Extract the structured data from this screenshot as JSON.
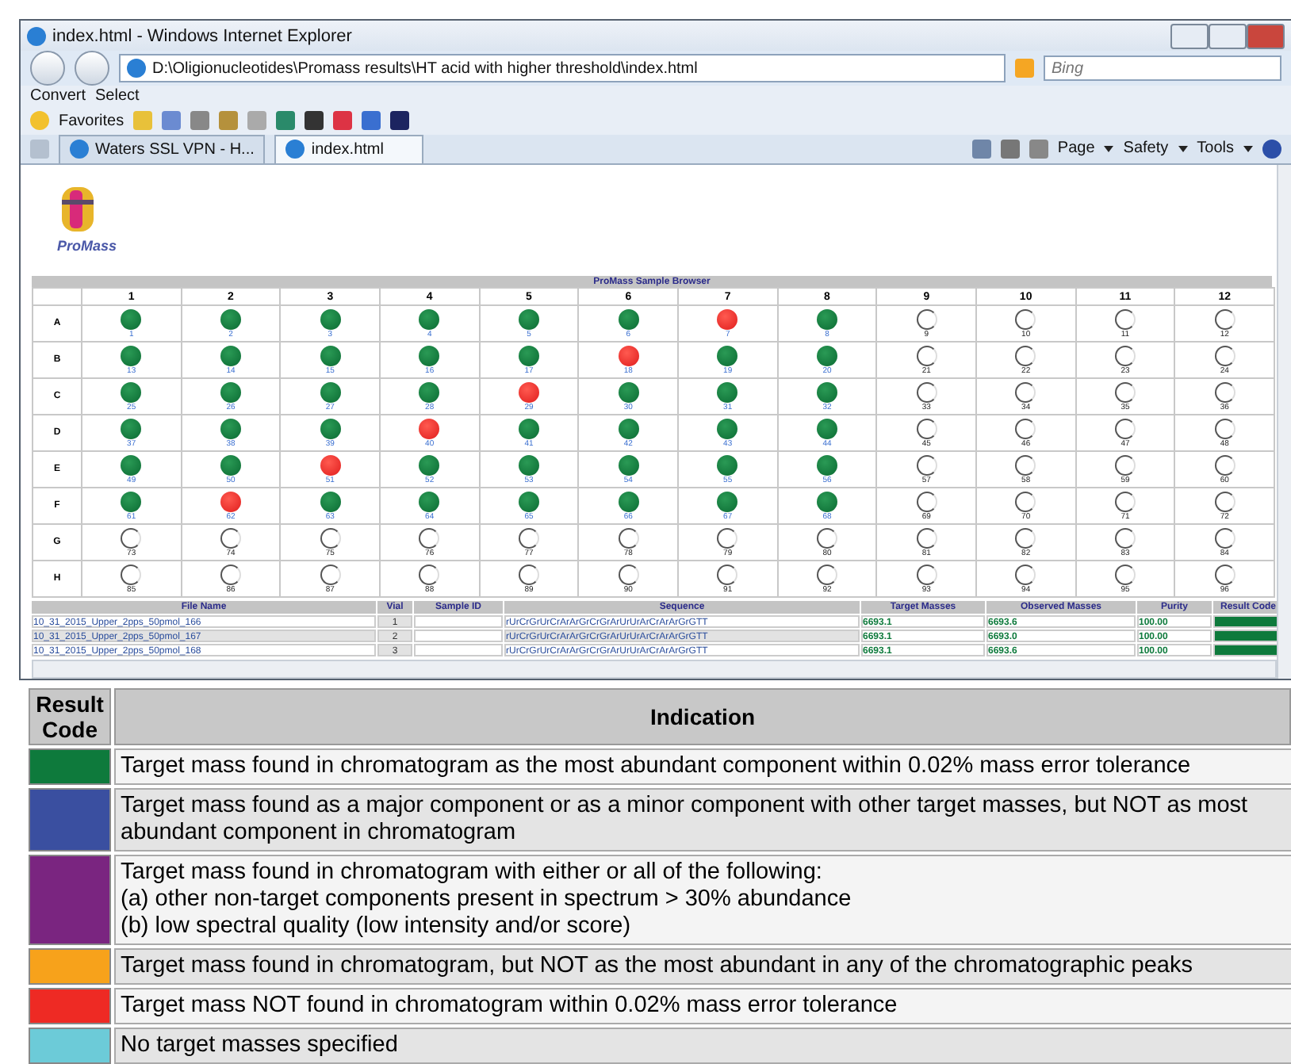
{
  "window": {
    "title": "index.html - Windows Internet Explorer"
  },
  "address_bar": {
    "url": "D:\\Oligionucleotides\\Promass results\\HT acid with higher threshold\\index.html",
    "search_placeholder": "Bing"
  },
  "command_bar": {
    "items": [
      "Convert",
      "Select"
    ]
  },
  "favorites_bar": {
    "label": "Favorites"
  },
  "tabs": [
    {
      "label": "Waters SSL VPN - H...",
      "selected": false
    },
    {
      "label": "index.html",
      "selected": true
    }
  ],
  "ie_toolbar": {
    "items": [
      "Page",
      "Safety",
      "Tools"
    ]
  },
  "logo": {
    "text": "ProMass"
  },
  "plate": {
    "title": "ProMass Sample Browser",
    "columns": [
      "1",
      "2",
      "3",
      "4",
      "5",
      "6",
      "7",
      "8",
      "9",
      "10",
      "11",
      "12"
    ],
    "rows": [
      {
        "label": "A",
        "wells": [
          {
            "n": "1",
            "kind": "found"
          },
          {
            "n": "2",
            "kind": "found"
          },
          {
            "n": "3",
            "kind": "found"
          },
          {
            "n": "4",
            "kind": "found"
          },
          {
            "n": "5",
            "kind": "found"
          },
          {
            "n": "6",
            "kind": "found"
          },
          {
            "n": "7",
            "kind": "not_found"
          },
          {
            "n": "8",
            "kind": "found"
          },
          {
            "n": "9",
            "kind": "empty"
          },
          {
            "n": "10",
            "kind": "empty"
          },
          {
            "n": "11",
            "kind": "empty"
          },
          {
            "n": "12",
            "kind": "empty"
          }
        ]
      },
      {
        "label": "B",
        "wells": [
          {
            "n": "13",
            "kind": "found"
          },
          {
            "n": "14",
            "kind": "found"
          },
          {
            "n": "15",
            "kind": "found"
          },
          {
            "n": "16",
            "kind": "found"
          },
          {
            "n": "17",
            "kind": "found"
          },
          {
            "n": "18",
            "kind": "not_found"
          },
          {
            "n": "19",
            "kind": "found"
          },
          {
            "n": "20",
            "kind": "found"
          },
          {
            "n": "21",
            "kind": "empty"
          },
          {
            "n": "22",
            "kind": "empty"
          },
          {
            "n": "23",
            "kind": "empty"
          },
          {
            "n": "24",
            "kind": "empty"
          }
        ]
      },
      {
        "label": "C",
        "wells": [
          {
            "n": "25",
            "kind": "found"
          },
          {
            "n": "26",
            "kind": "found"
          },
          {
            "n": "27",
            "kind": "found"
          },
          {
            "n": "28",
            "kind": "found"
          },
          {
            "n": "29",
            "kind": "not_found"
          },
          {
            "n": "30",
            "kind": "found"
          },
          {
            "n": "31",
            "kind": "found"
          },
          {
            "n": "32",
            "kind": "found"
          },
          {
            "n": "33",
            "kind": "empty"
          },
          {
            "n": "34",
            "kind": "empty"
          },
          {
            "n": "35",
            "kind": "empty"
          },
          {
            "n": "36",
            "kind": "empty"
          }
        ]
      },
      {
        "label": "D",
        "wells": [
          {
            "n": "37",
            "kind": "found"
          },
          {
            "n": "38",
            "kind": "found"
          },
          {
            "n": "39",
            "kind": "found"
          },
          {
            "n": "40",
            "kind": "not_found"
          },
          {
            "n": "41",
            "kind": "found"
          },
          {
            "n": "42",
            "kind": "found"
          },
          {
            "n": "43",
            "kind": "found"
          },
          {
            "n": "44",
            "kind": "found"
          },
          {
            "n": "45",
            "kind": "empty"
          },
          {
            "n": "46",
            "kind": "empty"
          },
          {
            "n": "47",
            "kind": "empty"
          },
          {
            "n": "48",
            "kind": "empty"
          }
        ]
      },
      {
        "label": "E",
        "wells": [
          {
            "n": "49",
            "kind": "found"
          },
          {
            "n": "50",
            "kind": "found"
          },
          {
            "n": "51",
            "kind": "not_found"
          },
          {
            "n": "52",
            "kind": "found"
          },
          {
            "n": "53",
            "kind": "found"
          },
          {
            "n": "54",
            "kind": "found"
          },
          {
            "n": "55",
            "kind": "found"
          },
          {
            "n": "56",
            "kind": "found"
          },
          {
            "n": "57",
            "kind": "empty"
          },
          {
            "n": "58",
            "kind": "empty"
          },
          {
            "n": "59",
            "kind": "empty"
          },
          {
            "n": "60",
            "kind": "empty"
          }
        ]
      },
      {
        "label": "F",
        "wells": [
          {
            "n": "61",
            "kind": "found"
          },
          {
            "n": "62",
            "kind": "not_found"
          },
          {
            "n": "63",
            "kind": "found"
          },
          {
            "n": "64",
            "kind": "found"
          },
          {
            "n": "65",
            "kind": "found"
          },
          {
            "n": "66",
            "kind": "found"
          },
          {
            "n": "67",
            "kind": "found"
          },
          {
            "n": "68",
            "kind": "found"
          },
          {
            "n": "69",
            "kind": "empty"
          },
          {
            "n": "70",
            "kind": "empty"
          },
          {
            "n": "71",
            "kind": "empty"
          },
          {
            "n": "72",
            "kind": "empty"
          }
        ]
      },
      {
        "label": "G",
        "wells": [
          {
            "n": "73",
            "kind": "empty"
          },
          {
            "n": "74",
            "kind": "empty"
          },
          {
            "n": "75",
            "kind": "empty"
          },
          {
            "n": "76",
            "kind": "empty"
          },
          {
            "n": "77",
            "kind": "empty"
          },
          {
            "n": "78",
            "kind": "empty"
          },
          {
            "n": "79",
            "kind": "empty"
          },
          {
            "n": "80",
            "kind": "empty"
          },
          {
            "n": "81",
            "kind": "empty"
          },
          {
            "n": "82",
            "kind": "empty"
          },
          {
            "n": "83",
            "kind": "empty"
          },
          {
            "n": "84",
            "kind": "empty"
          }
        ]
      },
      {
        "label": "H",
        "wells": [
          {
            "n": "85",
            "kind": "empty"
          },
          {
            "n": "86",
            "kind": "empty"
          },
          {
            "n": "87",
            "kind": "empty"
          },
          {
            "n": "88",
            "kind": "empty"
          },
          {
            "n": "89",
            "kind": "empty"
          },
          {
            "n": "90",
            "kind": "empty"
          },
          {
            "n": "91",
            "kind": "empty"
          },
          {
            "n": "92",
            "kind": "empty"
          },
          {
            "n": "93",
            "kind": "empty"
          },
          {
            "n": "94",
            "kind": "empty"
          },
          {
            "n": "95",
            "kind": "empty"
          },
          {
            "n": "96",
            "kind": "empty"
          }
        ]
      }
    ]
  },
  "results": {
    "columns": [
      "File Name",
      "Vial",
      "Sample ID",
      "Sequence",
      "Target Masses",
      "Observed Masses",
      "Purity",
      "Result Code"
    ],
    "rows": [
      {
        "file": "10_31_2015_Upper_2pps_50pmol_166",
        "vial": "1",
        "sequence": "rUrCrGrUrCrArArGrCrGrArUrUrArCrArArGrGTT",
        "target": "6693.1",
        "observed": "6693.6",
        "purity": "100.00",
        "color": "#0e7a3c"
      },
      {
        "file": "10_31_2015_Upper_2pps_50pmol_167",
        "vial": "2",
        "sequence": "rUrCrGrUrCrArArGrCrGrArUrUrArCrArArGrGTT",
        "target": "6693.1",
        "observed": "6693.0",
        "purity": "100.00",
        "color": "#0e7a3c"
      },
      {
        "file": "10_31_2015_Upper_2pps_50pmol_168",
        "vial": "3",
        "sequence": "rUrCrGrUrCrArArGrCrGrArUrUrArCrArArGrGTT",
        "target": "6693.1",
        "observed": "6693.6",
        "purity": "100.00",
        "color": "#0e7a3c"
      }
    ]
  },
  "legend": {
    "columns": [
      "Result Code",
      "Indication"
    ],
    "rows": [
      {
        "color": "#0e7a3c",
        "lines": [
          "Target mass found in chromatogram as the most abundant component within 0.02% mass error tolerance"
        ]
      },
      {
        "color": "#3a4fa0",
        "lines": [
          "Target mass found as a major component or as a minor component with other target masses, but NOT as most abundant component in chromatogram"
        ]
      },
      {
        "color": "#7a2580",
        "lines": [
          "Target mass found in chromatogram with either or all of the following:",
          "(a) other non-target components present in spectrum > 30% abundance",
          "(b) low spectral quality (low intensity and/or score)"
        ]
      },
      {
        "color": "#f7a21b",
        "lines": [
          "Target mass found in chromatogram, but NOT as the most abundant in any of the chromatographic peaks"
        ]
      },
      {
        "color": "#ee2a24",
        "lines": [
          "Target mass NOT found in chromatogram within 0.02% mass error tolerance"
        ]
      },
      {
        "color": "#6ccbd8",
        "lines": [
          "No target masses specified"
        ]
      }
    ]
  }
}
